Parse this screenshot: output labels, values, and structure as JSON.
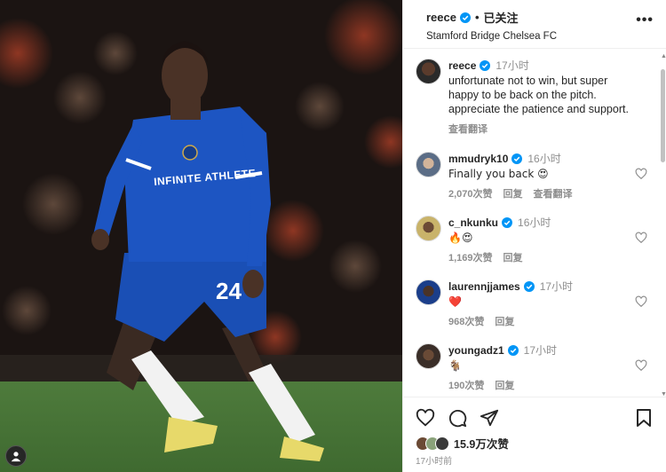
{
  "post": {
    "username": "reece",
    "follow_status": "已关注",
    "location": "Stamford Bridge Chelsea FC",
    "more_label": "•••"
  },
  "photo": {
    "jersey_sponsor": "INFINITE ATHLETE",
    "jersey_number": "24"
  },
  "caption": {
    "username": "reece",
    "time": "17小时",
    "text": "unfortunate not to win, but super happy to be back on the pitch. appreciate the patience and support.",
    "translate": "查看翻译"
  },
  "comments": [
    {
      "username": "mmudryk10",
      "time": "16小时",
      "text": "Finally you back 😍",
      "likes": "2,070次赞",
      "reply": "回复",
      "translate": "查看翻译"
    },
    {
      "username": "c_nkunku",
      "time": "16小时",
      "text": "🔥😍",
      "likes": "1,169次赞",
      "reply": "回复",
      "translate": ""
    },
    {
      "username": "laurennjjames",
      "time": "17小时",
      "text": "❤️",
      "likes": "968次赞",
      "reply": "回复",
      "translate": ""
    },
    {
      "username": "youngadz1",
      "time": "17小时",
      "text": "🐐",
      "likes": "190次赞",
      "reply": "回复",
      "translate": ""
    }
  ],
  "footer": {
    "likes": "15.9万次赞",
    "time": "17小时前"
  },
  "colors": {
    "verified": "#0095f6",
    "jersey": "#1a4fb5",
    "heart_red": "#ed4956"
  },
  "icons": [
    "verified-icon",
    "more-icon",
    "heart-icon",
    "comment-icon",
    "share-icon",
    "bookmark-icon"
  ]
}
